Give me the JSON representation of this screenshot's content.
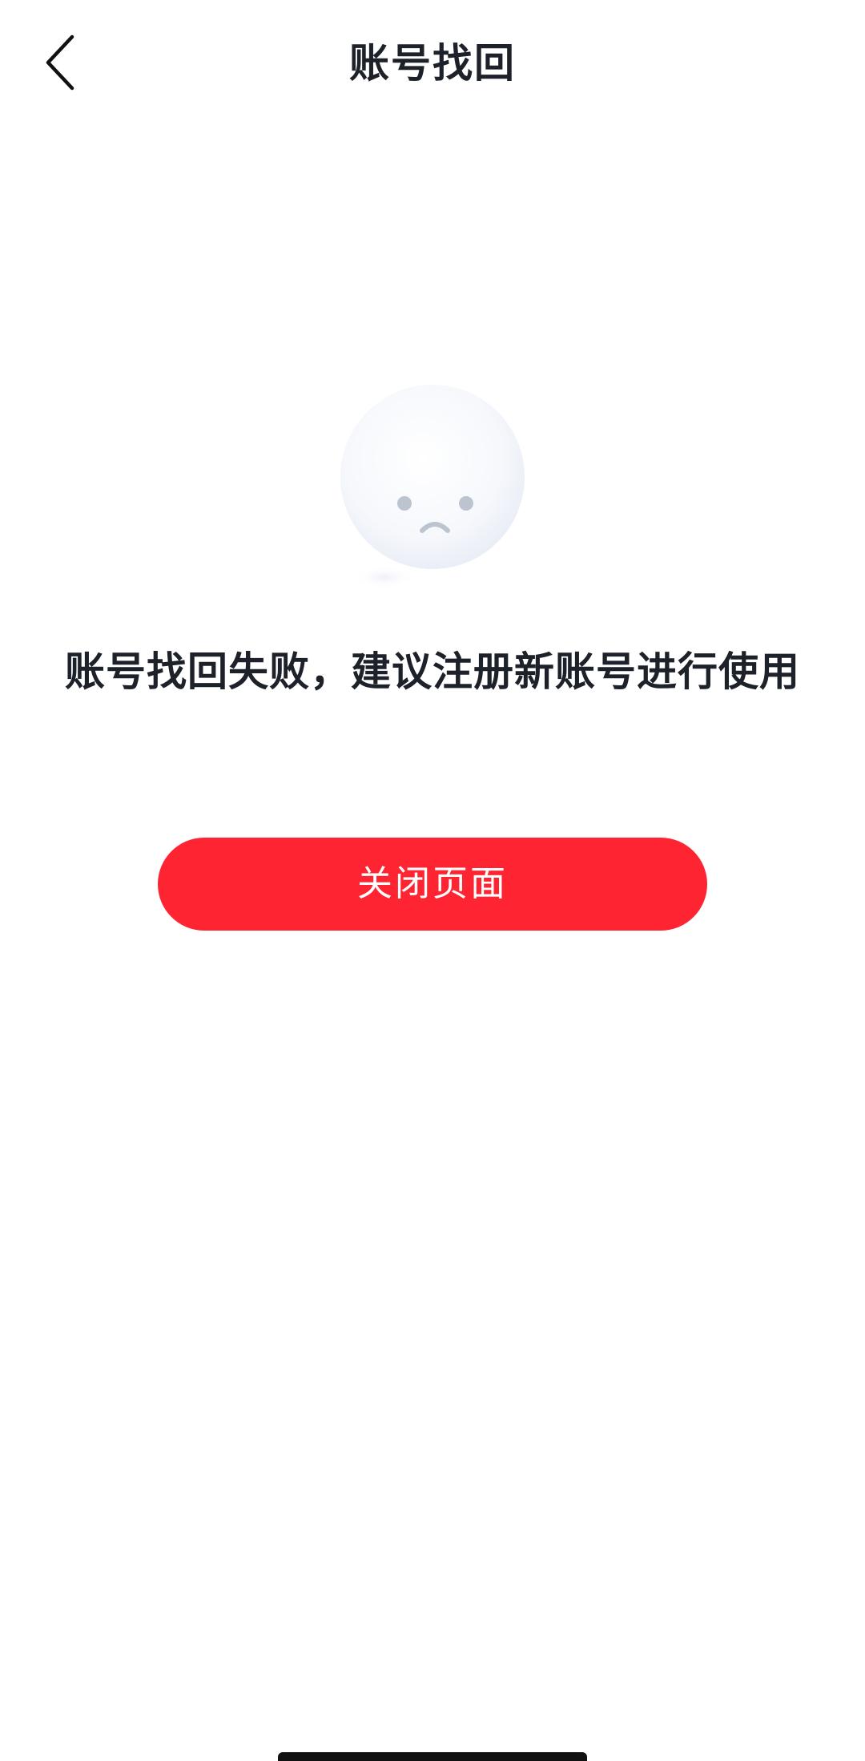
{
  "header": {
    "title": "账号找回",
    "back_icon": "chevron-left-icon"
  },
  "illustration": {
    "icon": "sad-face-icon"
  },
  "result": {
    "message": "账号找回失败，建议注册新账号进行使用"
  },
  "actions": {
    "close_label": "关闭页面"
  },
  "colors": {
    "primary": "#fe2432",
    "title_text": "#1d2129",
    "face_features": "#bcc4d0"
  }
}
